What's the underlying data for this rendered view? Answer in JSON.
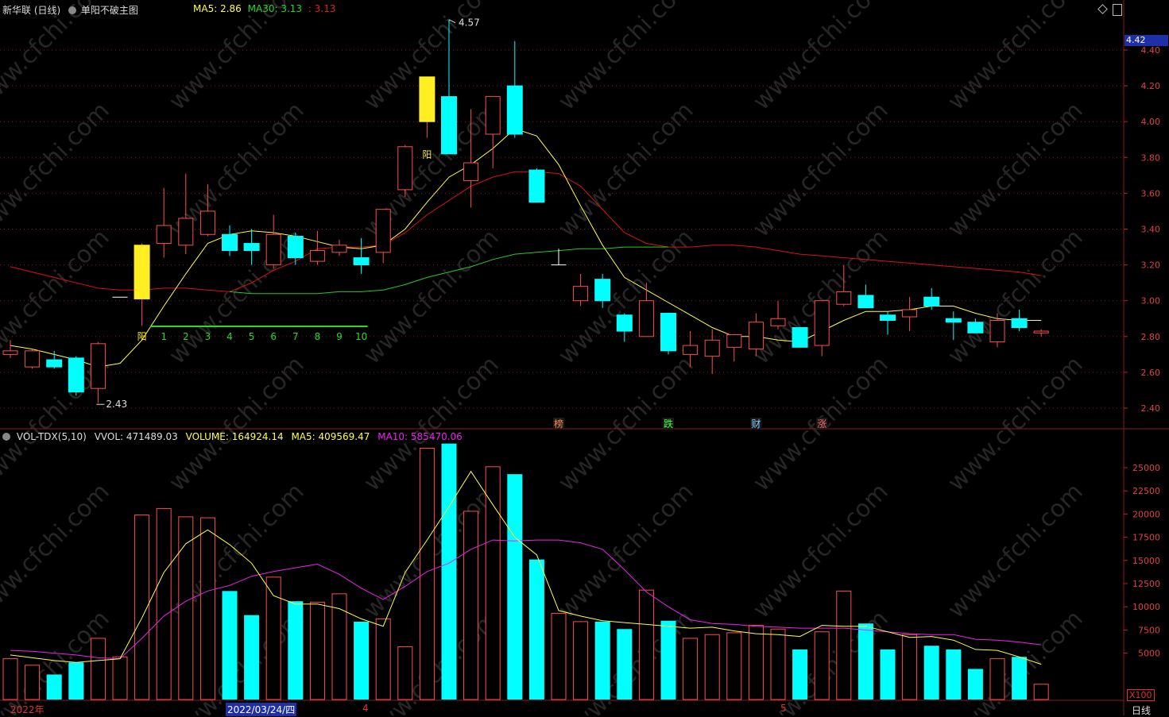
{
  "header": {
    "stock": "新华联 (日线)",
    "formula": "单阳不破主图",
    "ma5_label": "MA5:",
    "ma5_value": "2.86",
    "ma30_label": "MA30:",
    "ma30_value": "3.13",
    "extra_value": "3.13"
  },
  "volume_header": {
    "indicator": "VOL-TDX(5,10)",
    "vvol": "VVOL: 471489.03",
    "volume": "VOLUME: 164924.14",
    "ma5": "MA5: 409569.47",
    "ma10": "MA10: 585470.06"
  },
  "price_badge": "4.42",
  "price_axis": [
    "4.40",
    "4.20",
    "4.00",
    "3.80",
    "3.60",
    "3.40",
    "3.20",
    "3.00",
    "2.80",
    "2.60",
    "2.40"
  ],
  "volume_axis": [
    "25000",
    "22500",
    "20000",
    "17500",
    "15000",
    "12500",
    "10000",
    "7500",
    "5000"
  ],
  "volume_unit": "X100",
  "period_label": "日线",
  "date_axis": {
    "year": "2022年",
    "selected": "2022/03/24/四",
    "month4": "4",
    "month5": "5"
  },
  "annotations": {
    "high": "4.57",
    "low": "2.43",
    "yang1": "阳",
    "yang2": "阳",
    "counts": [
      "1",
      "2",
      "3",
      "4",
      "5",
      "6",
      "7",
      "8",
      "9",
      "10"
    ],
    "events": [
      "榜",
      "跌",
      "财",
      "涨"
    ]
  },
  "colors": {
    "up": "#ff4d4d",
    "down": "#00ffff",
    "ma_fast": "#ffff44",
    "ma_red": "#dd1111",
    "ma_green": "#22cc22",
    "ma10": "#ee22ee",
    "signal": "#ffee22",
    "grid": "#7a1a1a"
  },
  "chart_data": {
    "type": "candlestick",
    "price_range": [
      2.3,
      4.52
    ],
    "volume_range": [
      0,
      28000
    ],
    "candles": [
      {
        "o": 2.7,
        "h": 2.78,
        "l": 2.68,
        "c": 2.72,
        "v": 4400
      },
      {
        "o": 2.72,
        "h": 2.73,
        "l": 2.62,
        "c": 2.63,
        "v": 3700
      },
      {
        "o": 2.63,
        "h": 2.72,
        "l": 2.62,
        "c": 2.67,
        "v": 2700,
        "down": true
      },
      {
        "o": 2.68,
        "h": 2.69,
        "l": 2.47,
        "c": 2.49,
        "v": 4000,
        "down": true
      },
      {
        "o": 2.51,
        "h": 2.77,
        "l": 2.43,
        "c": 2.76,
        "v": 6600
      },
      {
        "o": 3.02,
        "h": 3.02,
        "l": 3.02,
        "c": 3.02,
        "v": 4600,
        "doji": true
      },
      {
        "o": 3.01,
        "h": 3.32,
        "l": 2.86,
        "c": 3.31,
        "v": 19900,
        "signal": true
      },
      {
        "o": 3.32,
        "h": 3.63,
        "l": 3.24,
        "c": 3.42,
        "v": 20600
      },
      {
        "o": 3.31,
        "h": 3.71,
        "l": 3.26,
        "c": 3.46,
        "v": 19700
      },
      {
        "o": 3.37,
        "h": 3.65,
        "l": 3.36,
        "c": 3.5,
        "v": 19600
      },
      {
        "o": 3.37,
        "h": 3.42,
        "l": 3.25,
        "c": 3.28,
        "v": 11700,
        "down": true
      },
      {
        "o": 3.32,
        "h": 3.4,
        "l": 3.2,
        "c": 3.28,
        "v": 9100,
        "down": true
      },
      {
        "o": 3.2,
        "h": 3.48,
        "l": 3.18,
        "c": 3.37,
        "v": 13200
      },
      {
        "o": 3.36,
        "h": 3.38,
        "l": 3.2,
        "c": 3.24,
        "v": 10600,
        "down": true
      },
      {
        "o": 3.22,
        "h": 3.39,
        "l": 3.2,
        "c": 3.28,
        "v": 10500
      },
      {
        "o": 3.27,
        "h": 3.34,
        "l": 3.25,
        "c": 3.31,
        "v": 11400
      },
      {
        "o": 3.24,
        "h": 3.35,
        "l": 3.15,
        "c": 3.2,
        "v": 8400,
        "down": true
      },
      {
        "o": 3.27,
        "h": 3.44,
        "l": 3.21,
        "c": 3.51,
        "v": 8700
      },
      {
        "o": 3.62,
        "h": 3.87,
        "l": 3.58,
        "c": 3.86,
        "v": 5700
      },
      {
        "o": 4.0,
        "h": 4.25,
        "l": 3.91,
        "c": 4.25,
        "v": 27100,
        "signal": true
      },
      {
        "o": 4.14,
        "h": 4.57,
        "l": 3.82,
        "c": 3.82,
        "v": 27600,
        "down": true
      },
      {
        "o": 3.67,
        "h": 4.07,
        "l": 3.52,
        "c": 3.77,
        "v": 20300
      },
      {
        "o": 3.93,
        "h": 4.14,
        "l": 3.74,
        "c": 4.14,
        "v": 25100
      },
      {
        "o": 4.2,
        "h": 4.45,
        "l": 3.91,
        "c": 3.93,
        "v": 24300,
        "down": true
      },
      {
        "o": 3.73,
        "h": 3.74,
        "l": 3.55,
        "c": 3.55,
        "v": 15100,
        "down": true
      },
      {
        "o": 3.2,
        "h": 3.29,
        "l": 3.2,
        "c": 3.2,
        "v": 9300,
        "doji": true
      },
      {
        "o": 3.0,
        "h": 3.15,
        "l": 2.97,
        "c": 3.08,
        "v": 8400
      },
      {
        "o": 3.12,
        "h": 3.15,
        "l": 2.96,
        "c": 3.0,
        "v": 8400,
        "down": true
      },
      {
        "o": 2.92,
        "h": 2.93,
        "l": 2.77,
        "c": 2.83,
        "v": 7600,
        "down": true
      },
      {
        "o": 2.8,
        "h": 3.1,
        "l": 2.8,
        "c": 3.0,
        "v": 11800
      },
      {
        "o": 2.93,
        "h": 2.93,
        "l": 2.7,
        "c": 2.72,
        "v": 8500,
        "down": true
      },
      {
        "o": 2.7,
        "h": 2.83,
        "l": 2.63,
        "c": 2.75,
        "v": 6600
      },
      {
        "o": 2.69,
        "h": 2.84,
        "l": 2.59,
        "c": 2.78,
        "v": 7000
      },
      {
        "o": 2.74,
        "h": 2.8,
        "l": 2.66,
        "c": 2.81,
        "v": 7200
      },
      {
        "o": 2.73,
        "h": 2.93,
        "l": 2.69,
        "c": 2.88,
        "v": 8000
      },
      {
        "o": 2.86,
        "h": 3.0,
        "l": 2.84,
        "c": 2.9,
        "v": 7600
      },
      {
        "o": 2.85,
        "h": 2.85,
        "l": 2.74,
        "c": 2.74,
        "v": 5400,
        "down": true
      },
      {
        "o": 2.75,
        "h": 3.0,
        "l": 2.69,
        "c": 3.0,
        "v": 7300
      },
      {
        "o": 2.98,
        "h": 3.2,
        "l": 2.97,
        "c": 3.05,
        "v": 11700
      },
      {
        "o": 3.03,
        "h": 3.09,
        "l": 2.96,
        "c": 2.96,
        "v": 8200,
        "down": true
      },
      {
        "o": 2.92,
        "h": 2.94,
        "l": 2.81,
        "c": 2.89,
        "v": 5400,
        "down": true
      },
      {
        "o": 2.91,
        "h": 3.02,
        "l": 2.83,
        "c": 2.95,
        "v": 7000
      },
      {
        "o": 3.02,
        "h": 3.07,
        "l": 2.95,
        "c": 2.97,
        "v": 5800,
        "down": true
      },
      {
        "o": 2.9,
        "h": 2.94,
        "l": 2.78,
        "c": 2.88,
        "v": 5400,
        "down": true
      },
      {
        "o": 2.88,
        "h": 2.9,
        "l": 2.82,
        "c": 2.82,
        "v": 3300,
        "down": true
      },
      {
        "o": 2.77,
        "h": 2.93,
        "l": 2.74,
        "c": 2.89,
        "v": 4400
      },
      {
        "o": 2.9,
        "h": 2.95,
        "l": 2.83,
        "c": 2.85,
        "v": 4600,
        "down": true
      },
      {
        "o": 2.82,
        "h": 2.84,
        "l": 2.8,
        "c": 2.83,
        "v": 1650
      }
    ],
    "ma_fast": [
      2.75,
      2.73,
      2.7,
      2.67,
      2.63,
      2.65,
      2.78,
      2.97,
      3.15,
      3.32,
      3.37,
      3.39,
      3.38,
      3.36,
      3.33,
      3.3,
      3.29,
      3.31,
      3.4,
      3.55,
      3.69,
      3.76,
      3.85,
      3.96,
      3.92,
      3.76,
      3.53,
      3.31,
      3.13,
      3.06,
      2.99,
      2.92,
      2.85,
      2.8,
      2.8,
      2.78,
      2.77,
      2.83,
      2.89,
      2.94,
      2.94,
      2.95,
      2.97,
      2.97,
      2.93,
      2.9,
      2.89,
      2.89
    ],
    "ma_red": [
      3.19,
      3.16,
      3.13,
      3.1,
      3.07,
      3.06,
      3.06,
      3.07,
      3.07,
      3.06,
      3.05,
      3.1,
      3.17,
      3.22,
      3.29,
      3.3,
      3.3,
      3.31,
      3.38,
      3.48,
      3.56,
      3.64,
      3.69,
      3.72,
      3.72,
      3.71,
      3.64,
      3.51,
      3.38,
      3.32,
      3.3,
      3.3,
      3.31,
      3.31,
      3.3,
      3.28,
      3.26,
      3.25,
      3.24,
      3.23,
      3.22,
      3.21,
      3.2,
      3.19,
      3.18,
      3.17,
      3.16,
      3.14
    ],
    "ma_green": [
      null,
      null,
      null,
      null,
      null,
      null,
      null,
      null,
      null,
      null,
      3.05,
      3.04,
      3.04,
      3.04,
      3.04,
      3.05,
      3.05,
      3.06,
      3.09,
      3.13,
      3.16,
      3.19,
      3.23,
      3.26,
      3.27,
      3.28,
      3.29,
      3.29,
      3.3,
      3.3,
      3.3
    ],
    "vol_ma5": [
      4800,
      4500,
      4200,
      4000,
      4200,
      4400,
      8800,
      13700,
      16800,
      18300,
      16700,
      14700,
      11200,
      10300,
      10300,
      9800,
      8700,
      7900,
      13700,
      17200,
      20800,
      24600,
      21000,
      17500,
      15600,
      9600,
      9000,
      8500,
      8300,
      8100,
      7900,
      7700,
      7800,
      7400,
      7100,
      7000,
      6800,
      8000,
      7900,
      7900,
      7300,
      6700,
      6800,
      6400,
      5400,
      5300,
      4600,
      3800
    ],
    "vol_ma10": [
      5300,
      5200,
      5000,
      4800,
      4500,
      4400,
      6600,
      9000,
      10600,
      11700,
      12300,
      13300,
      13800,
      14200,
      14600,
      13500,
      12000,
      10800,
      12200,
      13800,
      14700,
      16200,
      17200,
      17100,
      17200,
      17200,
      16900,
      16200,
      14000,
      11600,
      10000,
      8600,
      8200,
      8100,
      7900,
      7800,
      7700,
      7700,
      7700,
      7500,
      7300,
      7100,
      7000,
      7000,
      6500,
      6400,
      6200,
      5900
    ]
  }
}
